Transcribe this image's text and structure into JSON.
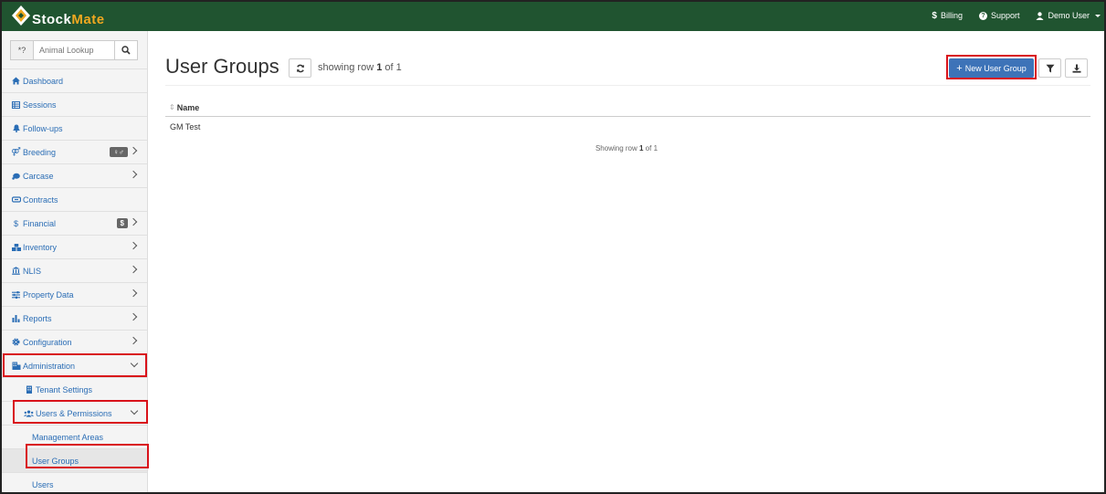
{
  "brand": {
    "name_part1": "Stock",
    "name_part2": "Mate"
  },
  "topnav": {
    "billing": "Billing",
    "support": "Support",
    "user": "Demo User"
  },
  "search": {
    "prefix": "*?",
    "placeholder": "Animal Lookup"
  },
  "menu": [
    {
      "label": "Dashboard",
      "icon": "home-icon"
    },
    {
      "label": "Sessions",
      "icon": "list-icon"
    },
    {
      "label": "Follow-ups",
      "icon": "bell-icon"
    },
    {
      "label": "Breeding",
      "icon": "gender-icon",
      "badge": "♀♂"
    },
    {
      "label": "Carcase",
      "icon": "meat-icon"
    },
    {
      "label": "Contracts",
      "icon": "handshake-icon"
    },
    {
      "label": "Financial",
      "icon": "dollar-icon",
      "badge": "$"
    },
    {
      "label": "Inventory",
      "icon": "boxes-icon"
    },
    {
      "label": "NLIS",
      "icon": "bank-icon"
    },
    {
      "label": "Property Data",
      "icon": "sliders-icon"
    },
    {
      "label": "Reports",
      "icon": "bar-chart-icon"
    },
    {
      "label": "Configuration",
      "icon": "gear-icon"
    },
    {
      "label": "Administration",
      "icon": "building-icon"
    },
    {
      "label": "Tenant Settings",
      "icon": "building-icon"
    },
    {
      "label": "Users & Permissions",
      "icon": "users-icon"
    },
    {
      "label": "Management Areas"
    },
    {
      "label": "User Groups"
    },
    {
      "label": "Users"
    }
  ],
  "main": {
    "title": "User Groups",
    "showing_prefix": "showing row ",
    "showing_row": "1",
    "showing_suffix": " of 1",
    "new_button": "New User Group",
    "column_name": "Name",
    "rows": [
      "GM Test"
    ],
    "footer_prefix": "Showing row ",
    "footer_row": "1",
    "footer_suffix": " of 1"
  },
  "colors": {
    "topbar": "#205430",
    "accent": "#f0a820",
    "link": "#2a6db5",
    "primary_button": "#3d73b8",
    "highlight": "#d9121a"
  }
}
